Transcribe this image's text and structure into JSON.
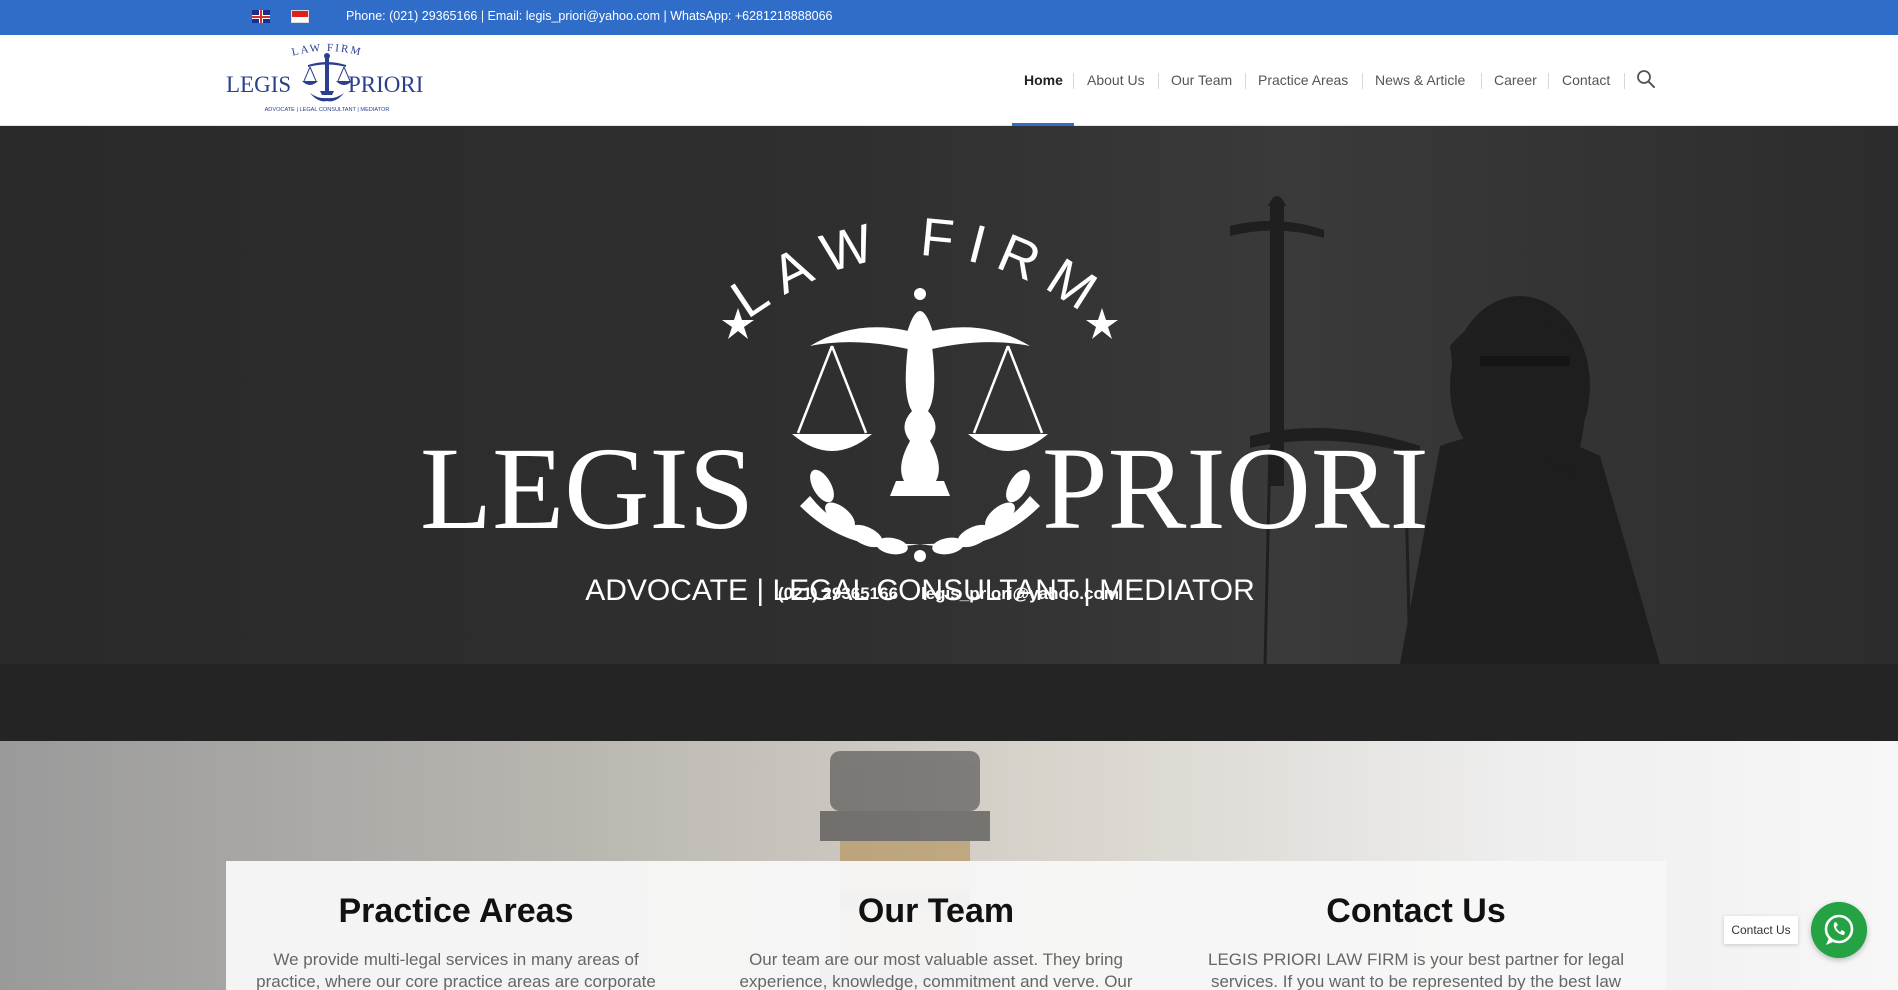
{
  "topbar": {
    "languages": [
      {
        "code": "en",
        "icon": "uk-flag-icon"
      },
      {
        "code": "id",
        "icon": "indonesia-flag-icon"
      }
    ],
    "contact_text": "Phone: (021) 29365166 | Email: legis_priori@yahoo.com | WhatsApp: +6281218888066"
  },
  "header": {
    "logo": {
      "top_text": "LAW FIRM",
      "left_text": "LEGIS",
      "right_text": "PRIORI",
      "tagline": "ADVOCATE | LEGAL CONSULTANT | MEDIATOR"
    },
    "nav": [
      {
        "label": "Home",
        "active": true
      },
      {
        "label": "About Us",
        "active": false
      },
      {
        "label": "Our Team",
        "active": false
      },
      {
        "label": "Practice Areas",
        "active": false
      },
      {
        "label": "News & Article",
        "active": false
      },
      {
        "label": "Career",
        "active": false
      },
      {
        "label": "Contact",
        "active": false
      }
    ],
    "search_icon": "search-icon"
  },
  "hero": {
    "logo_arc_text": "LAW FIRM",
    "logo_left": "LEGIS",
    "logo_right": "PRIORI",
    "tagline": "ADVOCATE | LEGAL CONSULTANT | MEDIATOR",
    "phone": "(021) 29365166",
    "email": "legis_priori@yahoo.com"
  },
  "cards": [
    {
      "title": "Practice Areas",
      "text": "We provide multi-legal services in many areas of practice, where our core practice areas are corporate and mergers"
    },
    {
      "title": "Our Team",
      "text": "Our team are our most valuable asset. They bring experience, knowledge, commitment and verve. Our"
    },
    {
      "title": "Contact Us",
      "text": "LEGIS PRIORI LAW FIRM is your best partner for legal services. If you want to be represented by the best law firm"
    }
  ],
  "whatsapp": {
    "label": "Contact Us",
    "icon": "whatsapp-icon"
  },
  "colors": {
    "topbar": "#2f6dc9",
    "whatsapp": "#25a244",
    "hero_bg": "#2f2f2f"
  }
}
